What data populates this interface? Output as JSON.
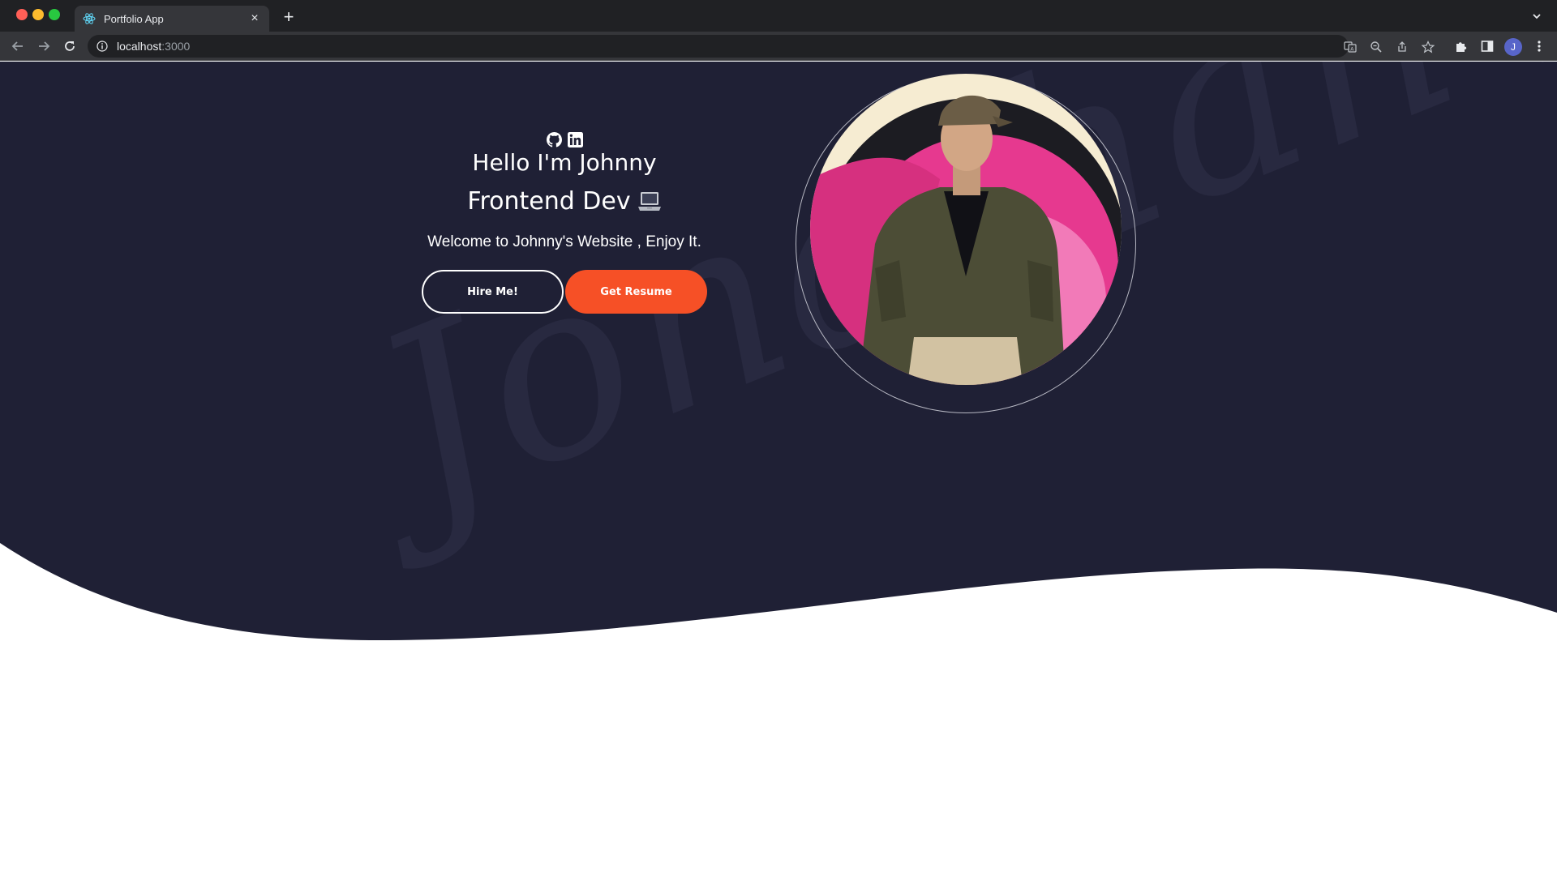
{
  "browser": {
    "tab_title": "Portfolio App",
    "tab_close": "×",
    "new_tab": "+",
    "url_host": "localhost",
    "url_port": ":3000",
    "profile_initial": "J"
  },
  "hero": {
    "greeting": "Hello I'm Johnny",
    "role": "Frontend Dev",
    "welcome": "Welcome to Johnny's Website , Enjoy It.",
    "hire_label": "Hire Me!",
    "resume_label": "Get Resume",
    "signature_text": "Jonathan Doe",
    "social_icons": [
      "github-icon",
      "linkedin-icon"
    ]
  },
  "colors": {
    "hero_bg": "#1f2035",
    "accent": "#f65026",
    "text": "#ffffff"
  }
}
